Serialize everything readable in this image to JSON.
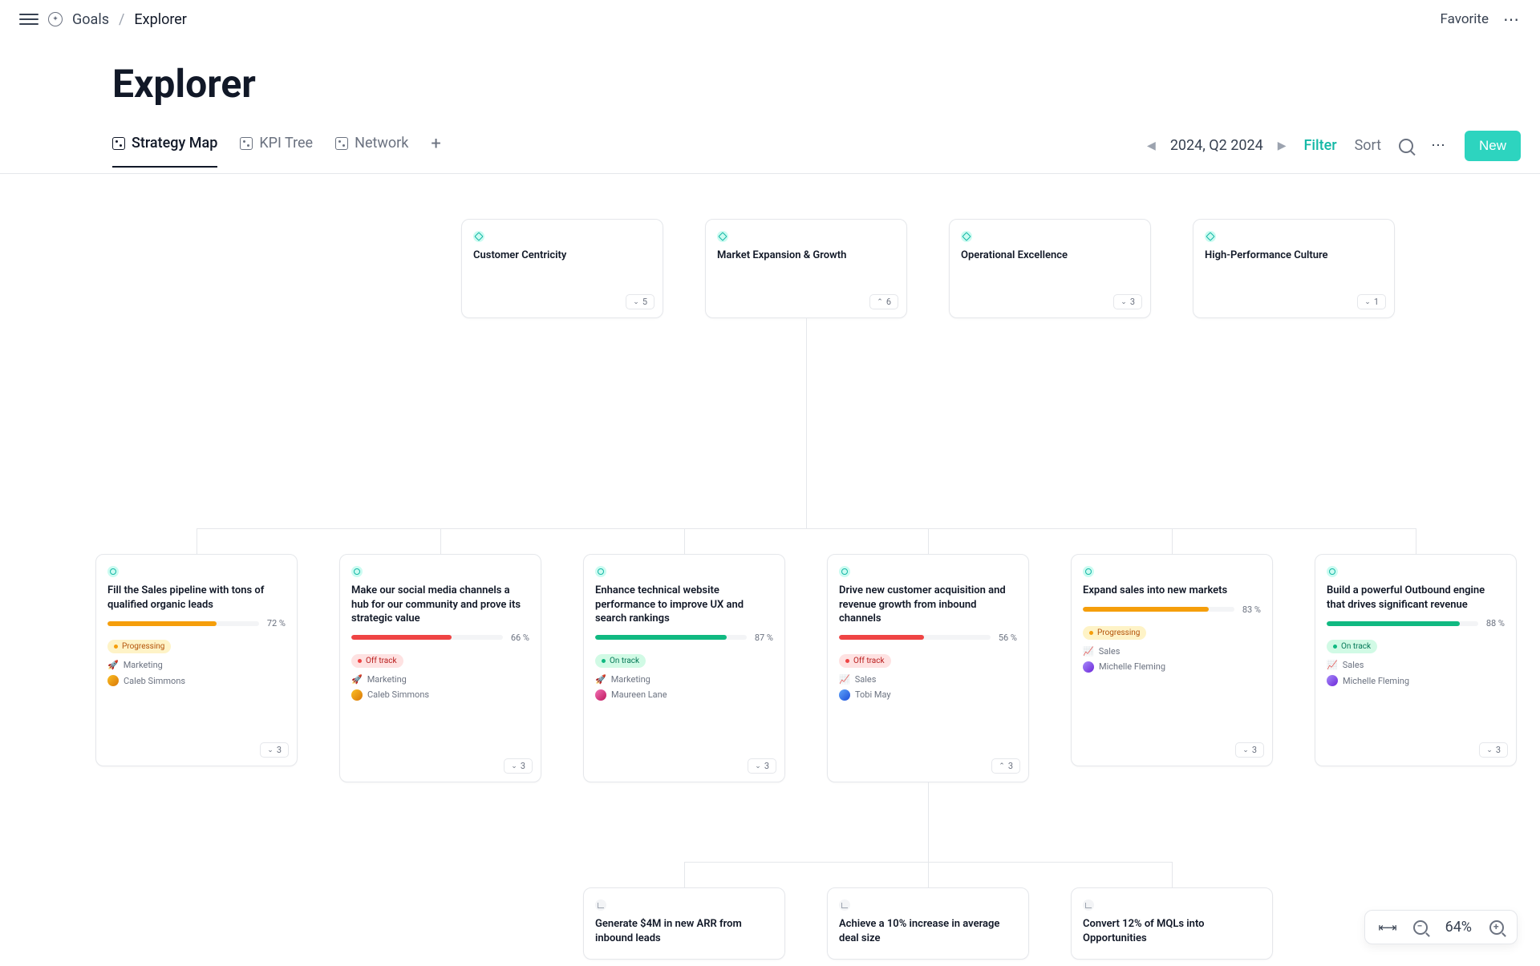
{
  "breadcrumb": {
    "root": "Goals",
    "current": "Explorer"
  },
  "page_title": "Explorer",
  "tabs": [
    {
      "label": "Strategy Map",
      "active": true
    },
    {
      "label": "KPI Tree",
      "active": false
    },
    {
      "label": "Network",
      "active": false
    }
  ],
  "toolbar": {
    "period": "2024, Q2 2024",
    "filter": "Filter",
    "sort": "Sort",
    "new": "New",
    "favorite": "Favorite"
  },
  "pillars": [
    {
      "title": "Customer Centricity",
      "children": 5,
      "expanded": false
    },
    {
      "title": "Market Expansion & Growth",
      "children": 6,
      "expanded": true
    },
    {
      "title": "Operational Excellence",
      "children": 3,
      "expanded": false
    },
    {
      "title": "High-Performance Culture",
      "children": 1,
      "expanded": false
    }
  ],
  "nodes": [
    {
      "title": "Fill the Sales pipeline with tons of qualified organic leads",
      "progress": 72,
      "progress_label": "72 %",
      "color": "amber",
      "status": "Progressing",
      "status_class": "progressing",
      "team_emoji": "🚀",
      "team": "Marketing",
      "owner": "Caleb Simmons",
      "avatar": "a1",
      "children": 3,
      "expanded": false
    },
    {
      "title": "Make our social media channels a hub for our community and prove its strategic value",
      "progress": 66,
      "progress_label": "66 %",
      "color": "red",
      "status": "Off track",
      "status_class": "offtrack",
      "team_emoji": "🚀",
      "team": "Marketing",
      "owner": "Caleb Simmons",
      "avatar": "a1",
      "children": 3,
      "expanded": false
    },
    {
      "title": "Enhance technical website performance to improve UX and search rankings",
      "progress": 87,
      "progress_label": "87 %",
      "color": "green",
      "status": "On track",
      "status_class": "ontrack",
      "team_emoji": "🚀",
      "team": "Marketing",
      "owner": "Maureen Lane",
      "avatar": "a2",
      "children": 3,
      "expanded": false
    },
    {
      "title": "Drive new customer acquisition and revenue growth from inbound channels",
      "progress": 56,
      "progress_label": "56 %",
      "color": "red",
      "status": "Off track",
      "status_class": "offtrack",
      "team_emoji": "📈",
      "team": "Sales",
      "owner": "Tobi May",
      "avatar": "a3",
      "children": 3,
      "expanded": true
    },
    {
      "title": "Expand sales into new markets",
      "progress": 83,
      "progress_label": "83 %",
      "color": "amber",
      "status": "Progressing",
      "status_class": "progressing",
      "team_emoji": "📈",
      "team": "Sales",
      "owner": "Michelle Fleming",
      "avatar": "a4",
      "children": 3,
      "expanded": false
    },
    {
      "title": "Build a powerful Outbound engine that drives significant revenue",
      "progress": 88,
      "progress_label": "88 %",
      "color": "green",
      "status": "On track",
      "status_class": "ontrack",
      "team_emoji": "📈",
      "team": "Sales",
      "owner": "Michelle Fleming",
      "avatar": "a4",
      "children": 3,
      "expanded": false
    }
  ],
  "subnodes": [
    {
      "title": "Generate $4M in new ARR from inbound leads"
    },
    {
      "title": "Achieve a 10% increase in average deal size"
    },
    {
      "title": "Convert 12% of MQLs into Opportunities"
    }
  ],
  "zoom": {
    "level": "64%"
  }
}
